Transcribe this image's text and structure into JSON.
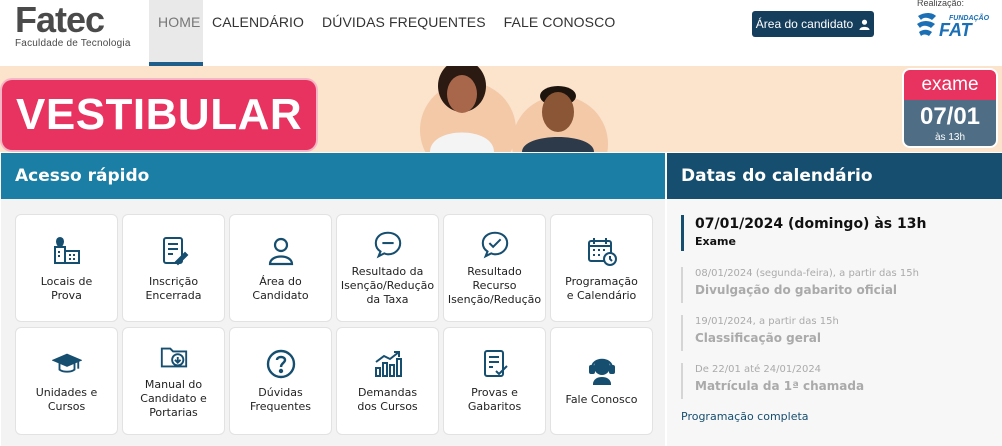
{
  "header": {
    "logo": {
      "name": "Fatec",
      "subtitle": "Faculdade de Tecnologia"
    },
    "nav": [
      "HOME",
      "CALENDÁRIO",
      "DÚVIDAS FREQUENTES",
      "FALE CONOSCO"
    ],
    "candidate_button": "Área do candidato",
    "realizacao_label": "Realização:",
    "fat_logo": {
      "top": "FUNDAÇÃO",
      "main": "FAT"
    }
  },
  "banner": {
    "title": "VESTIBULAR",
    "exam_label": "exame",
    "exam_date": "07/01",
    "exam_time": "às 13h"
  },
  "quick_access": {
    "title": "Acesso rápido",
    "tiles": [
      {
        "label": "Locais de\nProva",
        "icon": "building-map-icon"
      },
      {
        "label": "Inscrição\nEncerrada",
        "icon": "form-edit-icon"
      },
      {
        "label": "Área do\nCandidato",
        "icon": "user-icon"
      },
      {
        "label": "Resultado da\nIsenção/Redução\nda Taxa",
        "icon": "chat-minus-icon"
      },
      {
        "label": "Resultado\nRecurso\nIsenção/Redução",
        "icon": "chat-check-icon"
      },
      {
        "label": "Programação\ne Calendário",
        "icon": "calendar-clock-icon"
      },
      {
        "label": "Unidades e\nCursos",
        "icon": "graduation-cap-icon"
      },
      {
        "label": "Manual do\nCandidato e\nPortarias",
        "icon": "folder-download-icon"
      },
      {
        "label": "Dúvidas\nFrequentes",
        "icon": "question-icon"
      },
      {
        "label": "Demandas\ndos Cursos",
        "icon": "chart-up-icon"
      },
      {
        "label": "Provas e\nGabaritos",
        "icon": "document-check-icon"
      },
      {
        "label": "Fale Conosco",
        "icon": "headset-icon"
      }
    ]
  },
  "calendar": {
    "title": "Datas do calendário",
    "main_event": {
      "date": "07/01/2024 (domingo) às 13h",
      "name": "Exame"
    },
    "events": [
      {
        "date": "08/01/2024 (segunda-feira), a partir das 15h",
        "name": "Divulgação do gabarito oficial"
      },
      {
        "date": "19/01/2024, a partir das 15h",
        "name": "Classificação geral"
      },
      {
        "date": "De 22/01 até 24/01/2024",
        "name": "Matrícula da 1ª chamada"
      }
    ],
    "link": "Programação completa"
  },
  "colors": {
    "primary_dark": "#164e70",
    "primary": "#1a7ea5",
    "accent_pink": "#e8325f",
    "banner_bg": "#fbe3cc"
  }
}
